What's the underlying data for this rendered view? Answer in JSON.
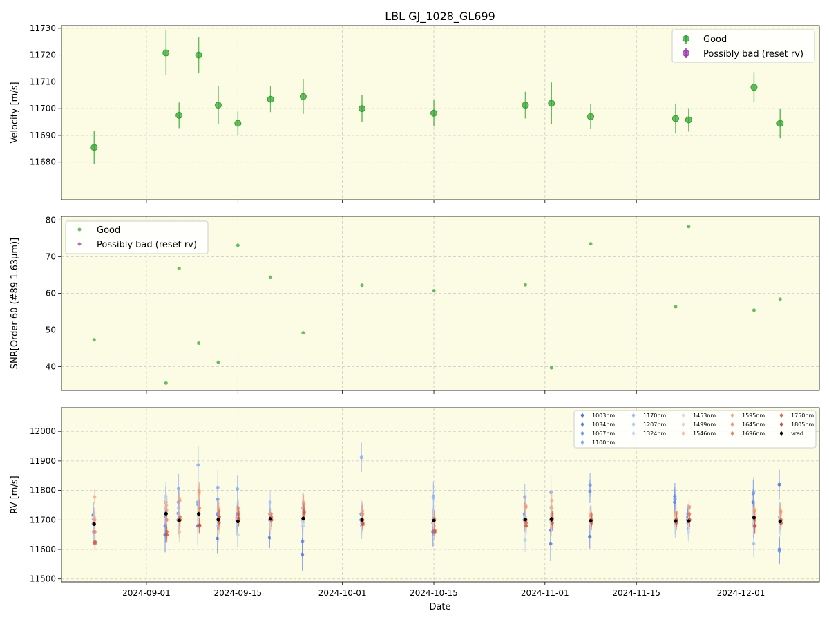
{
  "title": "LBL GJ_1028_GL699",
  "xlabel": "Date",
  "x_ticks": [
    "2024-09-01",
    "2024-09-15",
    "2024-10-01",
    "2024-10-15",
    "2024-11-01",
    "2024-11-15",
    "2024-12-01"
  ],
  "colors": {
    "background": "#fcfce4",
    "good": "#2ca02c",
    "bad": "#9933aa",
    "vrad": "#000000",
    "grid": "#c8c8c8"
  },
  "chart_data": [
    {
      "type": "scatter",
      "panel": "velocity",
      "ylabel": "Velocity [m/s]",
      "ylim": [
        11666,
        11731
      ],
      "yticks": [
        11680,
        11690,
        11700,
        11710,
        11720,
        11730
      ],
      "grid": true,
      "legend_position": "top-right",
      "legend": [
        "Good",
        "Possibly bad (reset rv)"
      ],
      "series": [
        {
          "name": "Good",
          "x": [
            "2024-08-24",
            "2024-09-04",
            "2024-09-06",
            "2024-09-09",
            "2024-09-12",
            "2024-09-15",
            "2024-09-20",
            "2024-09-25",
            "2024-10-04",
            "2024-10-15",
            "2024-10-29",
            "2024-11-02",
            "2024-11-08",
            "2024-11-21",
            "2024-11-23",
            "2024-12-03",
            "2024-12-07"
          ],
          "y": [
            11685.5,
            11720.8,
            11697.5,
            11720.0,
            11701.3,
            11694.5,
            11703.5,
            11704.5,
            11700.0,
            11698.3,
            11701.3,
            11702.0,
            11697.0,
            11696.3,
            11695.8,
            11708.0,
            11694.5
          ],
          "yerr": [
            6.2,
            8.4,
            4.8,
            6.6,
            7.2,
            4.4,
            4.8,
            6.5,
            5.0,
            5.0,
            5.0,
            7.8,
            4.6,
            5.6,
            4.4,
            5.6,
            5.6
          ]
        },
        {
          "name": "Possibly bad (reset rv)",
          "x": [],
          "y": [],
          "yerr": []
        }
      ]
    },
    {
      "type": "scatter",
      "panel": "snr",
      "ylabel": "SNR[Order 60 (#89 1.63μm)]",
      "ylim": [
        33.5,
        81
      ],
      "yticks": [
        40,
        50,
        60,
        70,
        80
      ],
      "grid": true,
      "legend_position": "top-left",
      "legend": [
        "Good",
        "Possibly bad (reset rv)"
      ],
      "series": [
        {
          "name": "Good",
          "x": [
            "2024-08-24",
            "2024-09-04",
            "2024-09-06",
            "2024-09-09",
            "2024-09-12",
            "2024-09-15",
            "2024-09-20",
            "2024-09-25",
            "2024-10-04",
            "2024-10-15",
            "2024-10-29",
            "2024-11-02",
            "2024-11-08",
            "2024-11-21",
            "2024-11-23",
            "2024-12-03",
            "2024-12-07"
          ],
          "y": [
            47.3,
            35.5,
            66.8,
            46.4,
            41.2,
            73.1,
            64.4,
            49.2,
            62.2,
            60.7,
            62.3,
            39.7,
            73.5,
            56.3,
            78.2,
            55.4,
            58.4
          ]
        },
        {
          "name": "Possibly bad (reset rv)",
          "x": [],
          "y": []
        }
      ]
    },
    {
      "type": "scatter",
      "panel": "rv",
      "ylabel": "RV [m/s]",
      "ylim": [
        11490,
        12080
      ],
      "yticks": [
        11500,
        11600,
        11700,
        11800,
        11900,
        12000
      ],
      "grid": true,
      "legend_position": "top-right",
      "legend_columns": [
        [
          "1003nm",
          "1034nm",
          "1067nm",
          "1100nm"
        ],
        [
          "1170nm",
          "1207nm",
          "1324nm"
        ],
        [
          "1453nm",
          "1499nm",
          "1546nm"
        ],
        [
          "1595nm",
          "1645nm",
          "1696nm"
        ],
        [
          "1750nm",
          "1805nm",
          "vrad"
        ]
      ],
      "wavelength_colors": {
        "1003nm": "#4a6fe0",
        "1034nm": "#5c7fe8",
        "1067nm": "#7094f0",
        "1100nm": "#85a8f5",
        "1170nm": "#9cbcf8",
        "1207nm": "#b2ccf8",
        "1324nm": "#c6d8f4",
        "1453nm": "#dadada",
        "1499nm": "#efcfbe",
        "1546nm": "#f5bda4",
        "1595nm": "#f4aa8c",
        "1645nm": "#ee9677",
        "1696nm": "#e48063",
        "1750nm": "#d86a52",
        "1805nm": "#cc5044"
      },
      "vrad": {
        "x": [
          "2024-08-24",
          "2024-09-04",
          "2024-09-06",
          "2024-09-09",
          "2024-09-12",
          "2024-09-15",
          "2024-09-20",
          "2024-09-25",
          "2024-10-04",
          "2024-10-15",
          "2024-10-29",
          "2024-11-02",
          "2024-11-08",
          "2024-11-21",
          "2024-11-23",
          "2024-12-03",
          "2024-12-07"
        ],
        "y": [
          11686,
          11721,
          11698,
          11720,
          11701,
          11695,
          11704,
          11705,
          11700,
          11698,
          11701,
          11702,
          11697,
          11696,
          11696,
          11708,
          11695
        ],
        "yerr": [
          6,
          8,
          5,
          7,
          7,
          4,
          5,
          7,
          5,
          5,
          5,
          8,
          5,
          6,
          4,
          6,
          6
        ]
      },
      "wavelength_points": [
        {
          "x": "2024-08-24",
          "y": [
            11716,
            11688,
            11702,
            11660,
            11690,
            11700,
            11680,
            11692,
            11700,
            11710,
            11778,
            11700,
            11660,
            11620,
            11625
          ],
          "yerr": [
            45,
            40,
            35,
            45,
            40,
            45,
            40,
            35,
            35,
            35,
            25,
            30,
            30,
            25,
            25
          ]
        },
        {
          "x": "2024-09-04",
          "y": [
            11650,
            11680,
            11712,
            11760,
            11740,
            11780,
            11770,
            11700,
            11720,
            11760,
            11750,
            11732,
            11700,
            11660,
            11650
          ],
          "yerr": [
            60,
            55,
            50,
            55,
            55,
            50,
            40,
            35,
            35,
            35,
            30,
            30,
            30,
            25,
            25
          ]
        },
        {
          "x": "2024-09-06",
          "y": [
            11700,
            11722,
            11760,
            11806,
            11740,
            11700,
            11680,
            11700,
            11690,
            11660,
            11772,
            11765,
            11700,
            11710,
            11700
          ],
          "yerr": [
            50,
            45,
            45,
            50,
            45,
            40,
            40,
            35,
            35,
            35,
            30,
            30,
            30,
            25,
            25
          ]
        },
        {
          "x": "2024-09-09",
          "y": [
            11680,
            11760,
            11752,
            11886,
            11760,
            11700,
            11700,
            11690,
            11720,
            11730,
            11790,
            11798,
            11740,
            11680,
            11682
          ],
          "yerr": [
            65,
            60,
            55,
            65,
            55,
            45,
            40,
            35,
            35,
            35,
            30,
            30,
            30,
            25,
            25
          ]
        },
        {
          "x": "2024-09-12",
          "y": [
            11637,
            11720,
            11770,
            11810,
            11700,
            11680,
            11700,
            11690,
            11660,
            11700,
            11740,
            11730,
            11700,
            11690,
            11710
          ],
          "yerr": [
            50,
            50,
            45,
            60,
            45,
            40,
            40,
            35,
            35,
            35,
            30,
            30,
            30,
            25,
            25
          ]
        },
        {
          "x": "2024-09-15",
          "y": [
            11700,
            11710,
            11720,
            11805,
            11650,
            11690,
            11700,
            11650,
            11700,
            11710,
            11730,
            11740,
            11700,
            11720,
            11705
          ],
          "yerr": [
            45,
            40,
            40,
            45,
            40,
            40,
            35,
            35,
            30,
            30,
            30,
            30,
            25,
            25,
            25
          ]
        },
        {
          "x": "2024-09-20",
          "y": [
            11640,
            11700,
            11720,
            11700,
            11760,
            11700,
            11690,
            11680,
            11670,
            11700,
            11720,
            11720,
            11700,
            11710,
            11700
          ],
          "yerr": [
            35,
            35,
            35,
            40,
            40,
            35,
            35,
            30,
            30,
            30,
            25,
            25,
            25,
            25,
            25
          ]
        },
        {
          "x": "2024-09-25",
          "y": [
            11583,
            11628,
            11700,
            11740,
            11700,
            11680,
            11690,
            11700,
            11710,
            11740,
            11760,
            11755,
            11720,
            11730,
            11725
          ],
          "yerr": [
            55,
            55,
            50,
            50,
            45,
            40,
            40,
            35,
            35,
            35,
            30,
            30,
            30,
            25,
            25
          ]
        },
        {
          "x": "2024-10-04",
          "y": [
            11700,
            11720,
            11700,
            11912,
            11680,
            11690,
            11700,
            11700,
            11700,
            11720,
            11730,
            11720,
            11700,
            11690,
            11685
          ],
          "yerr": [
            50,
            45,
            40,
            50,
            45,
            40,
            40,
            35,
            35,
            35,
            30,
            30,
            30,
            25,
            25
          ]
        },
        {
          "x": "2024-10-15",
          "y": [
            11660,
            11690,
            11700,
            11780,
            11775,
            11700,
            11690,
            11700,
            11700,
            11680,
            11700,
            11705,
            11700,
            11665,
            11660
          ],
          "yerr": [
            50,
            45,
            45,
            50,
            45,
            45,
            40,
            35,
            35,
            35,
            30,
            30,
            30,
            25,
            25
          ]
        },
        {
          "x": "2024-10-29",
          "y": [
            11700,
            11720,
            11700,
            11778,
            11710,
            11632,
            11700,
            11700,
            11690,
            11740,
            11750,
            11745,
            11700,
            11690,
            11680
          ],
          "yerr": [
            40,
            40,
            40,
            45,
            40,
            40,
            35,
            35,
            35,
            35,
            30,
            30,
            30,
            25,
            25
          ]
        },
        {
          "x": "2024-11-02",
          "y": [
            11620,
            11665,
            11700,
            11793,
            11742,
            11700,
            11690,
            11700,
            11680,
            11740,
            11765,
            11720,
            11700,
            11690,
            11705
          ],
          "yerr": [
            60,
            55,
            50,
            60,
            55,
            50,
            40,
            35,
            35,
            35,
            30,
            30,
            30,
            25,
            25
          ]
        },
        {
          "x": "2024-11-08",
          "y": [
            11643,
            11797,
            11818,
            11700,
            11710,
            11690,
            11700,
            11690,
            11700,
            11710,
            11720,
            11715,
            11700,
            11690,
            11700
          ],
          "yerr": [
            40,
            40,
            40,
            45,
            40,
            40,
            35,
            35,
            35,
            35,
            30,
            30,
            30,
            25,
            25
          ]
        },
        {
          "x": "2024-11-21",
          "y": [
            11760,
            11780,
            11770,
            11700,
            11680,
            11690,
            11700,
            11680,
            11700,
            11710,
            11720,
            11725,
            11700,
            11690,
            11700
          ],
          "yerr": [
            45,
            45,
            40,
            50,
            40,
            40,
            35,
            35,
            35,
            35,
            30,
            30,
            30,
            25,
            25
          ]
        },
        {
          "x": "2024-11-23",
          "y": [
            11700,
            11710,
            11720,
            11690,
            11670,
            11700,
            11660,
            11680,
            11700,
            11700,
            11740,
            11745,
            11720,
            11700,
            11700
          ],
          "yerr": [
            40,
            35,
            35,
            40,
            35,
            35,
            35,
            30,
            30,
            30,
            25,
            25,
            25,
            25,
            25
          ]
        },
        {
          "x": "2024-12-03",
          "y": [
            11760,
            11790,
            11680,
            11795,
            11620,
            11690,
            11700,
            11680,
            11700,
            11720,
            11735,
            11730,
            11700,
            11680,
            11680
          ],
          "yerr": [
            45,
            45,
            40,
            50,
            45,
            40,
            35,
            35,
            35,
            35,
            30,
            30,
            30,
            25,
            25
          ]
        },
        {
          "x": "2024-12-07",
          "y": [
            11820,
            11600,
            11595,
            11710,
            11700,
            11690,
            11700,
            11680,
            11700,
            11720,
            11725,
            11730,
            11700,
            11700,
            11690
          ],
          "yerr": [
            50,
            45,
            45,
            50,
            45,
            40,
            35,
            35,
            35,
            35,
            30,
            30,
            30,
            25,
            25
          ]
        }
      ]
    }
  ]
}
